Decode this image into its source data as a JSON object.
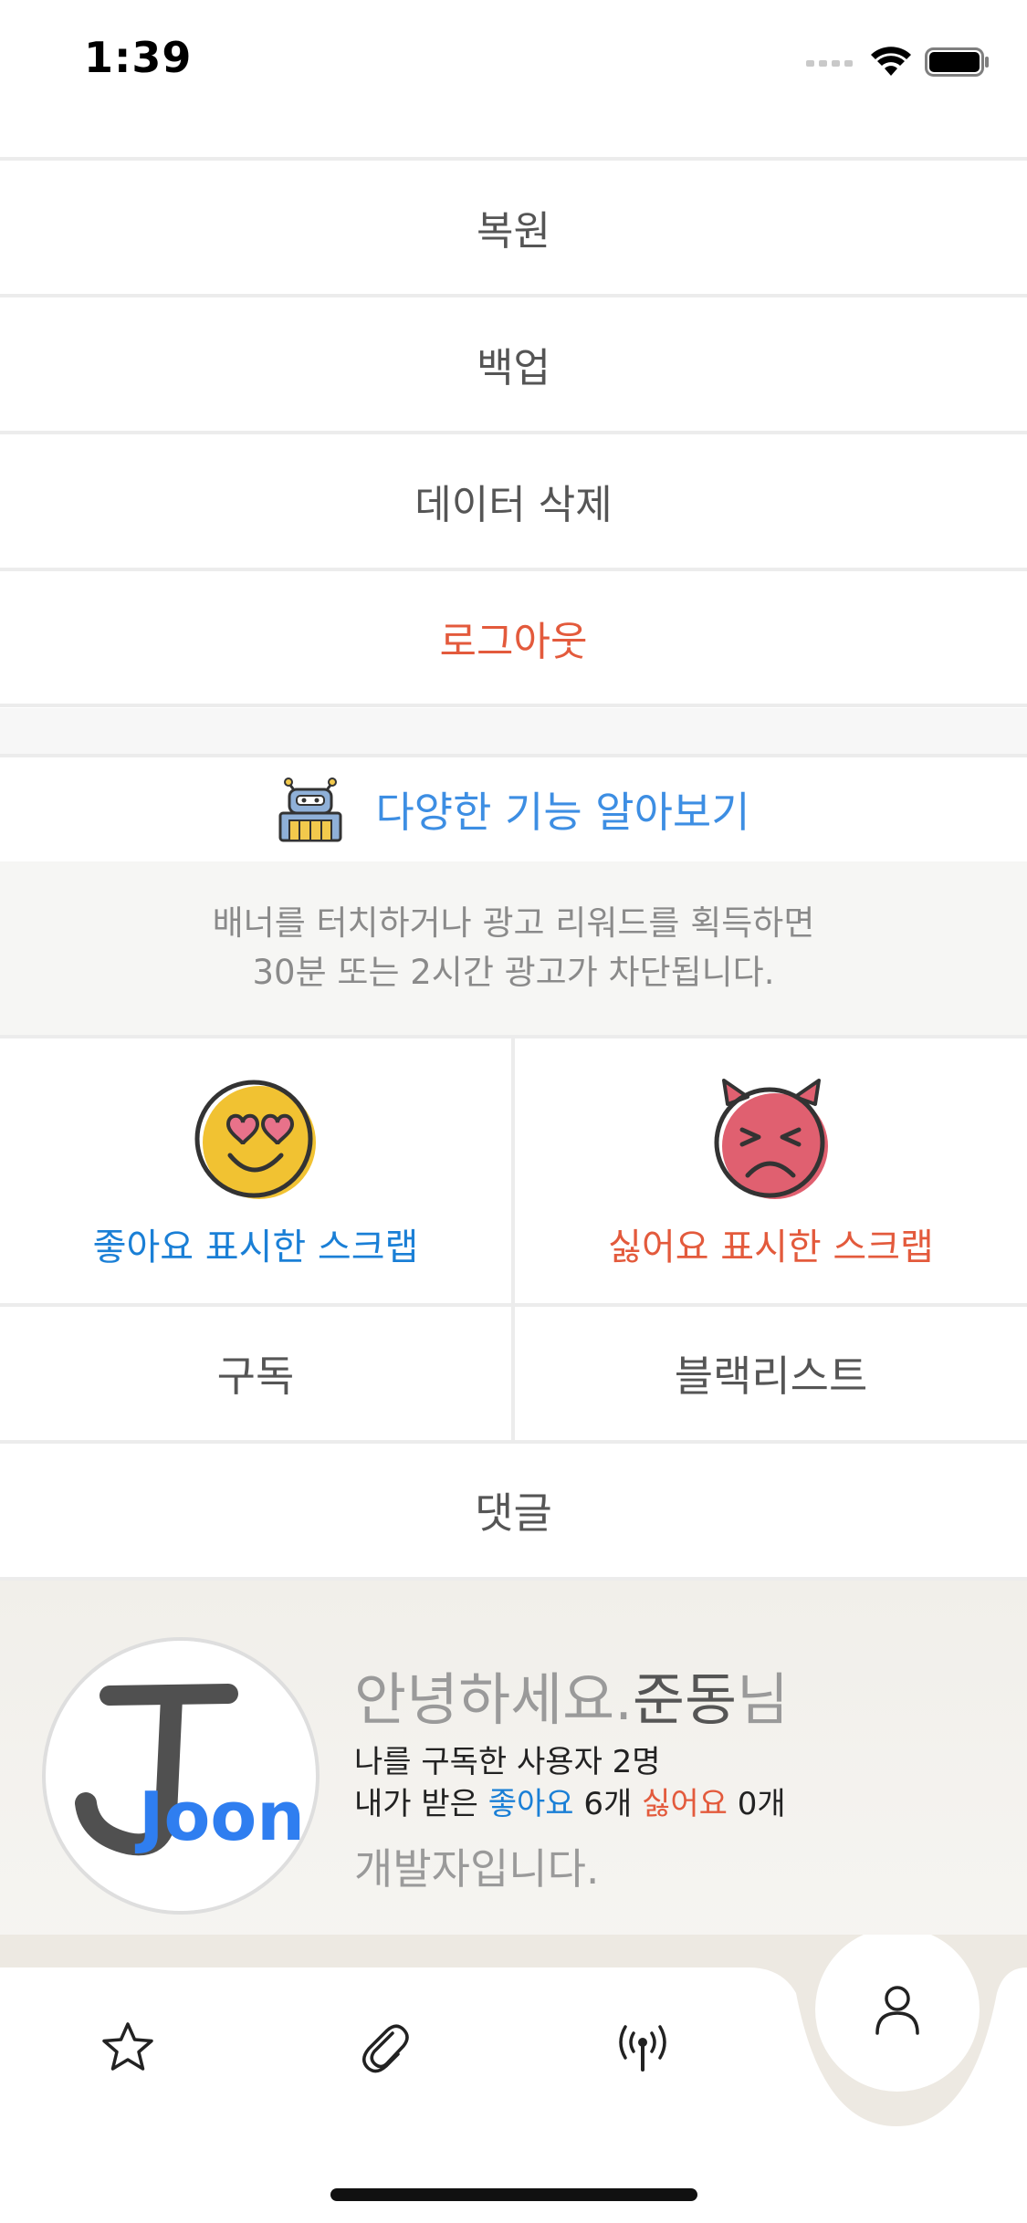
{
  "status": {
    "time": "1:39"
  },
  "menu": {
    "restore": "복원",
    "backup": "백업",
    "delete_data": "데이터 삭제",
    "logout": "로그아웃"
  },
  "feature": {
    "label": "다양한 기능 알아보기",
    "icon": "robot-icon"
  },
  "notice": {
    "line1": "배너를 터치하거나 광고 리워드를 획득하면",
    "line2": "30분 또는 2시간 광고가 차단됩니다."
  },
  "grid": {
    "liked_scraps": "좋아요 표시한 스크랩",
    "disliked_scraps": "싫어요 표시한 스크랩",
    "subscriptions": "구독",
    "blacklist": "블랙리스트",
    "comments": "댓글"
  },
  "profile": {
    "greeting": "안녕하세요.",
    "name": "준동",
    "honorific": "님",
    "subscribers_text": "나를 구독한 사용자 2명",
    "received_prefix": "내가 받은 ",
    "likes_word": "좋아요",
    "likes_count": " 6개 ",
    "dislikes_word": "싫어요",
    "dislikes_count": " 0개",
    "bio": "개발자입니다.",
    "avatar_text": "Joon"
  },
  "tabs": [
    "star-icon",
    "paperclip-icon",
    "broadcast-icon",
    "person-icon"
  ],
  "colors": {
    "accent_blue": "#1a7fd6",
    "logout_red": "#e35a3c",
    "tab_bg": "#ede9e2"
  }
}
